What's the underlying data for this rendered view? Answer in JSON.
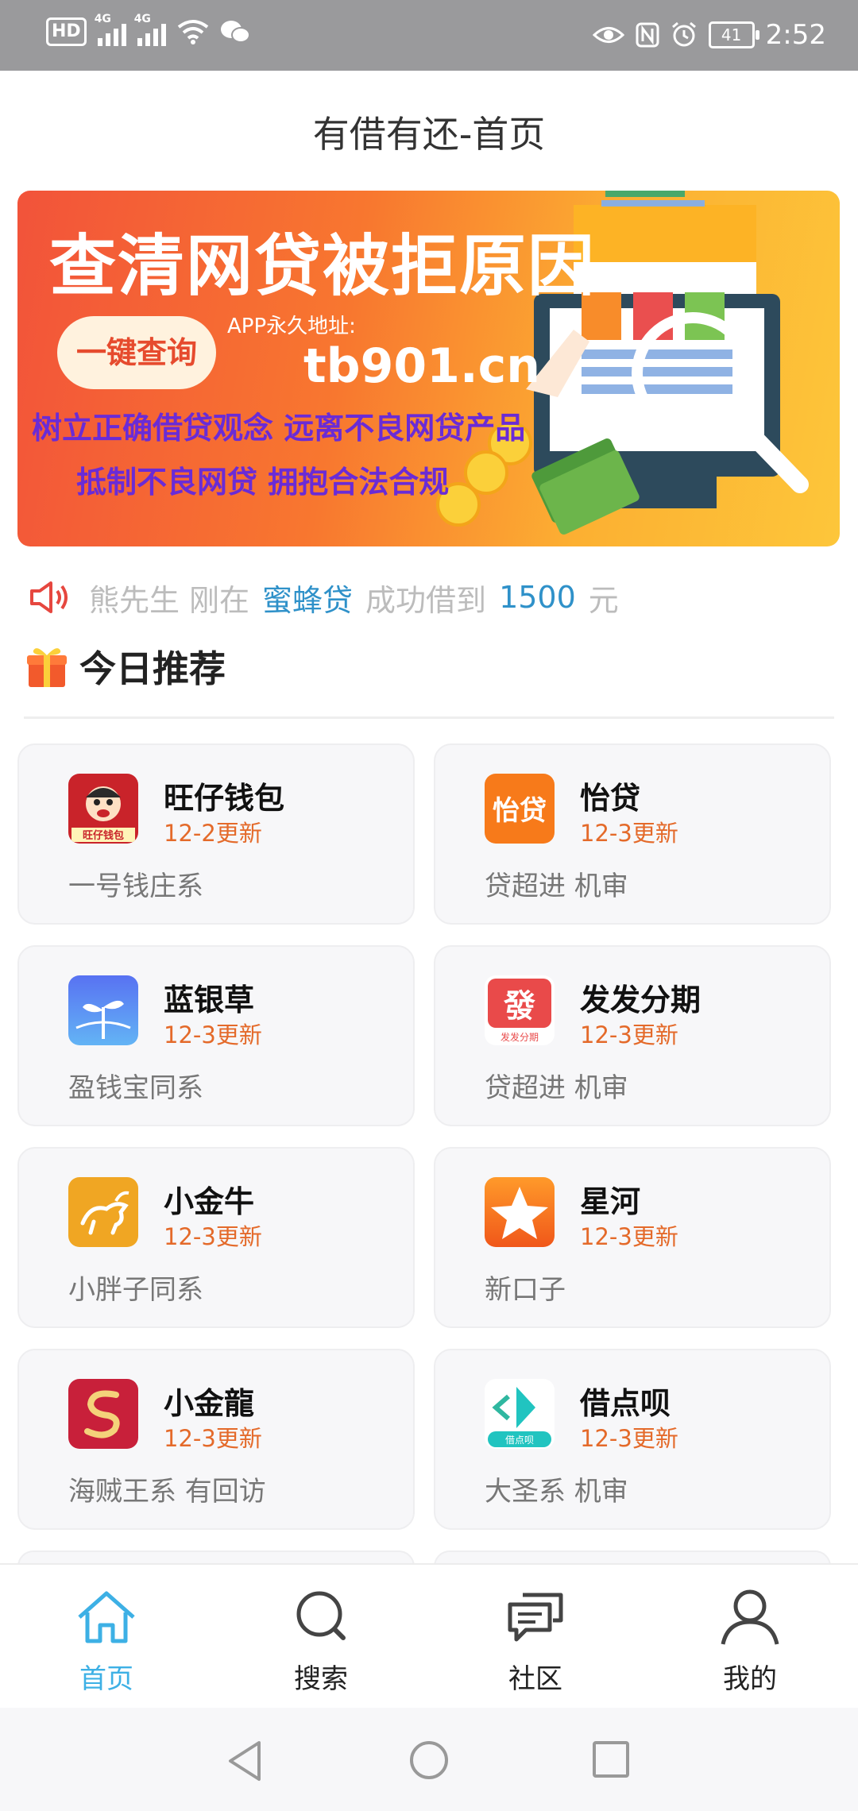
{
  "status_bar": {
    "left_icons": [
      "hd-icon",
      "signal-4g-icon",
      "signal-4g-icon",
      "wifi-icon",
      "wechat-icon"
    ],
    "hd": "HD",
    "net1": "4G",
    "net2": "4G",
    "right_icons": [
      "eye-icon",
      "nfc-icon",
      "alarm-icon",
      "battery-icon"
    ],
    "battery": "41",
    "time": "2:52"
  },
  "header": {
    "title": "有借有还-首页"
  },
  "banner": {
    "headline": "查清网贷被拒原因",
    "button": "一键查询",
    "url_label": "APP永久地址:",
    "url": "tb901.cn",
    "line1": "树立正确借贷观念 远离不良网贷产品",
    "line2": "抵制不良网贷 拥抱合法合规",
    "accent_colors": {
      "start": "#f2533a",
      "end": "#fdc63a",
      "text": "#6a2bd6"
    }
  },
  "notice": {
    "name": "熊先生",
    "text1": "刚在",
    "platform": "蜜蜂贷",
    "text2": "成功借到",
    "amount": "1500",
    "unit": "元"
  },
  "section": {
    "title": "今日推荐"
  },
  "cards": [
    {
      "name": "旺仔钱包",
      "update": "12-2更新",
      "desc": "一号钱庄系",
      "logo_text": "旺仔钱包",
      "logo_color": "#c9232a"
    },
    {
      "name": "怡贷",
      "update": "12-3更新",
      "desc": "贷超进 机审",
      "logo_text": "怡贷",
      "logo_color": "#f77a1a"
    },
    {
      "name": "蓝银草",
      "update": "12-3更新",
      "desc": "盈钱宝同系",
      "logo_text": "",
      "logo_color": "#4f6cf5"
    },
    {
      "name": "发发分期",
      "update": "12-3更新",
      "desc": "贷超进 机审",
      "logo_text": "發",
      "logo_sub": "发发分期",
      "logo_color": "#e94a4a"
    },
    {
      "name": "小金牛",
      "update": "12-3更新",
      "desc": "小胖子同系",
      "logo_text": "",
      "logo_color": "#f0a623"
    },
    {
      "name": "星河",
      "update": "12-3更新",
      "desc": "新口子",
      "logo_text": "",
      "logo_color": "#f57a1f"
    },
    {
      "name": "小金龍",
      "update": "12-3更新",
      "desc": "海贼王系 有回访",
      "logo_text": "",
      "logo_color": "#c8203a"
    },
    {
      "name": "借点呗",
      "update": "12-3更新",
      "desc": "大圣系 机审",
      "logo_text": "借点呗",
      "logo_color": "#21c4c0"
    }
  ],
  "bottom_nav": [
    {
      "label": "首页",
      "icon": "home-icon",
      "active": true
    },
    {
      "label": "搜索",
      "icon": "search-icon",
      "active": false
    },
    {
      "label": "社区",
      "icon": "chat-icon",
      "active": false
    },
    {
      "label": "我的",
      "icon": "user-icon",
      "active": false
    }
  ],
  "system_nav": [
    "back-icon",
    "home-circle-icon",
    "recents-icon"
  ]
}
